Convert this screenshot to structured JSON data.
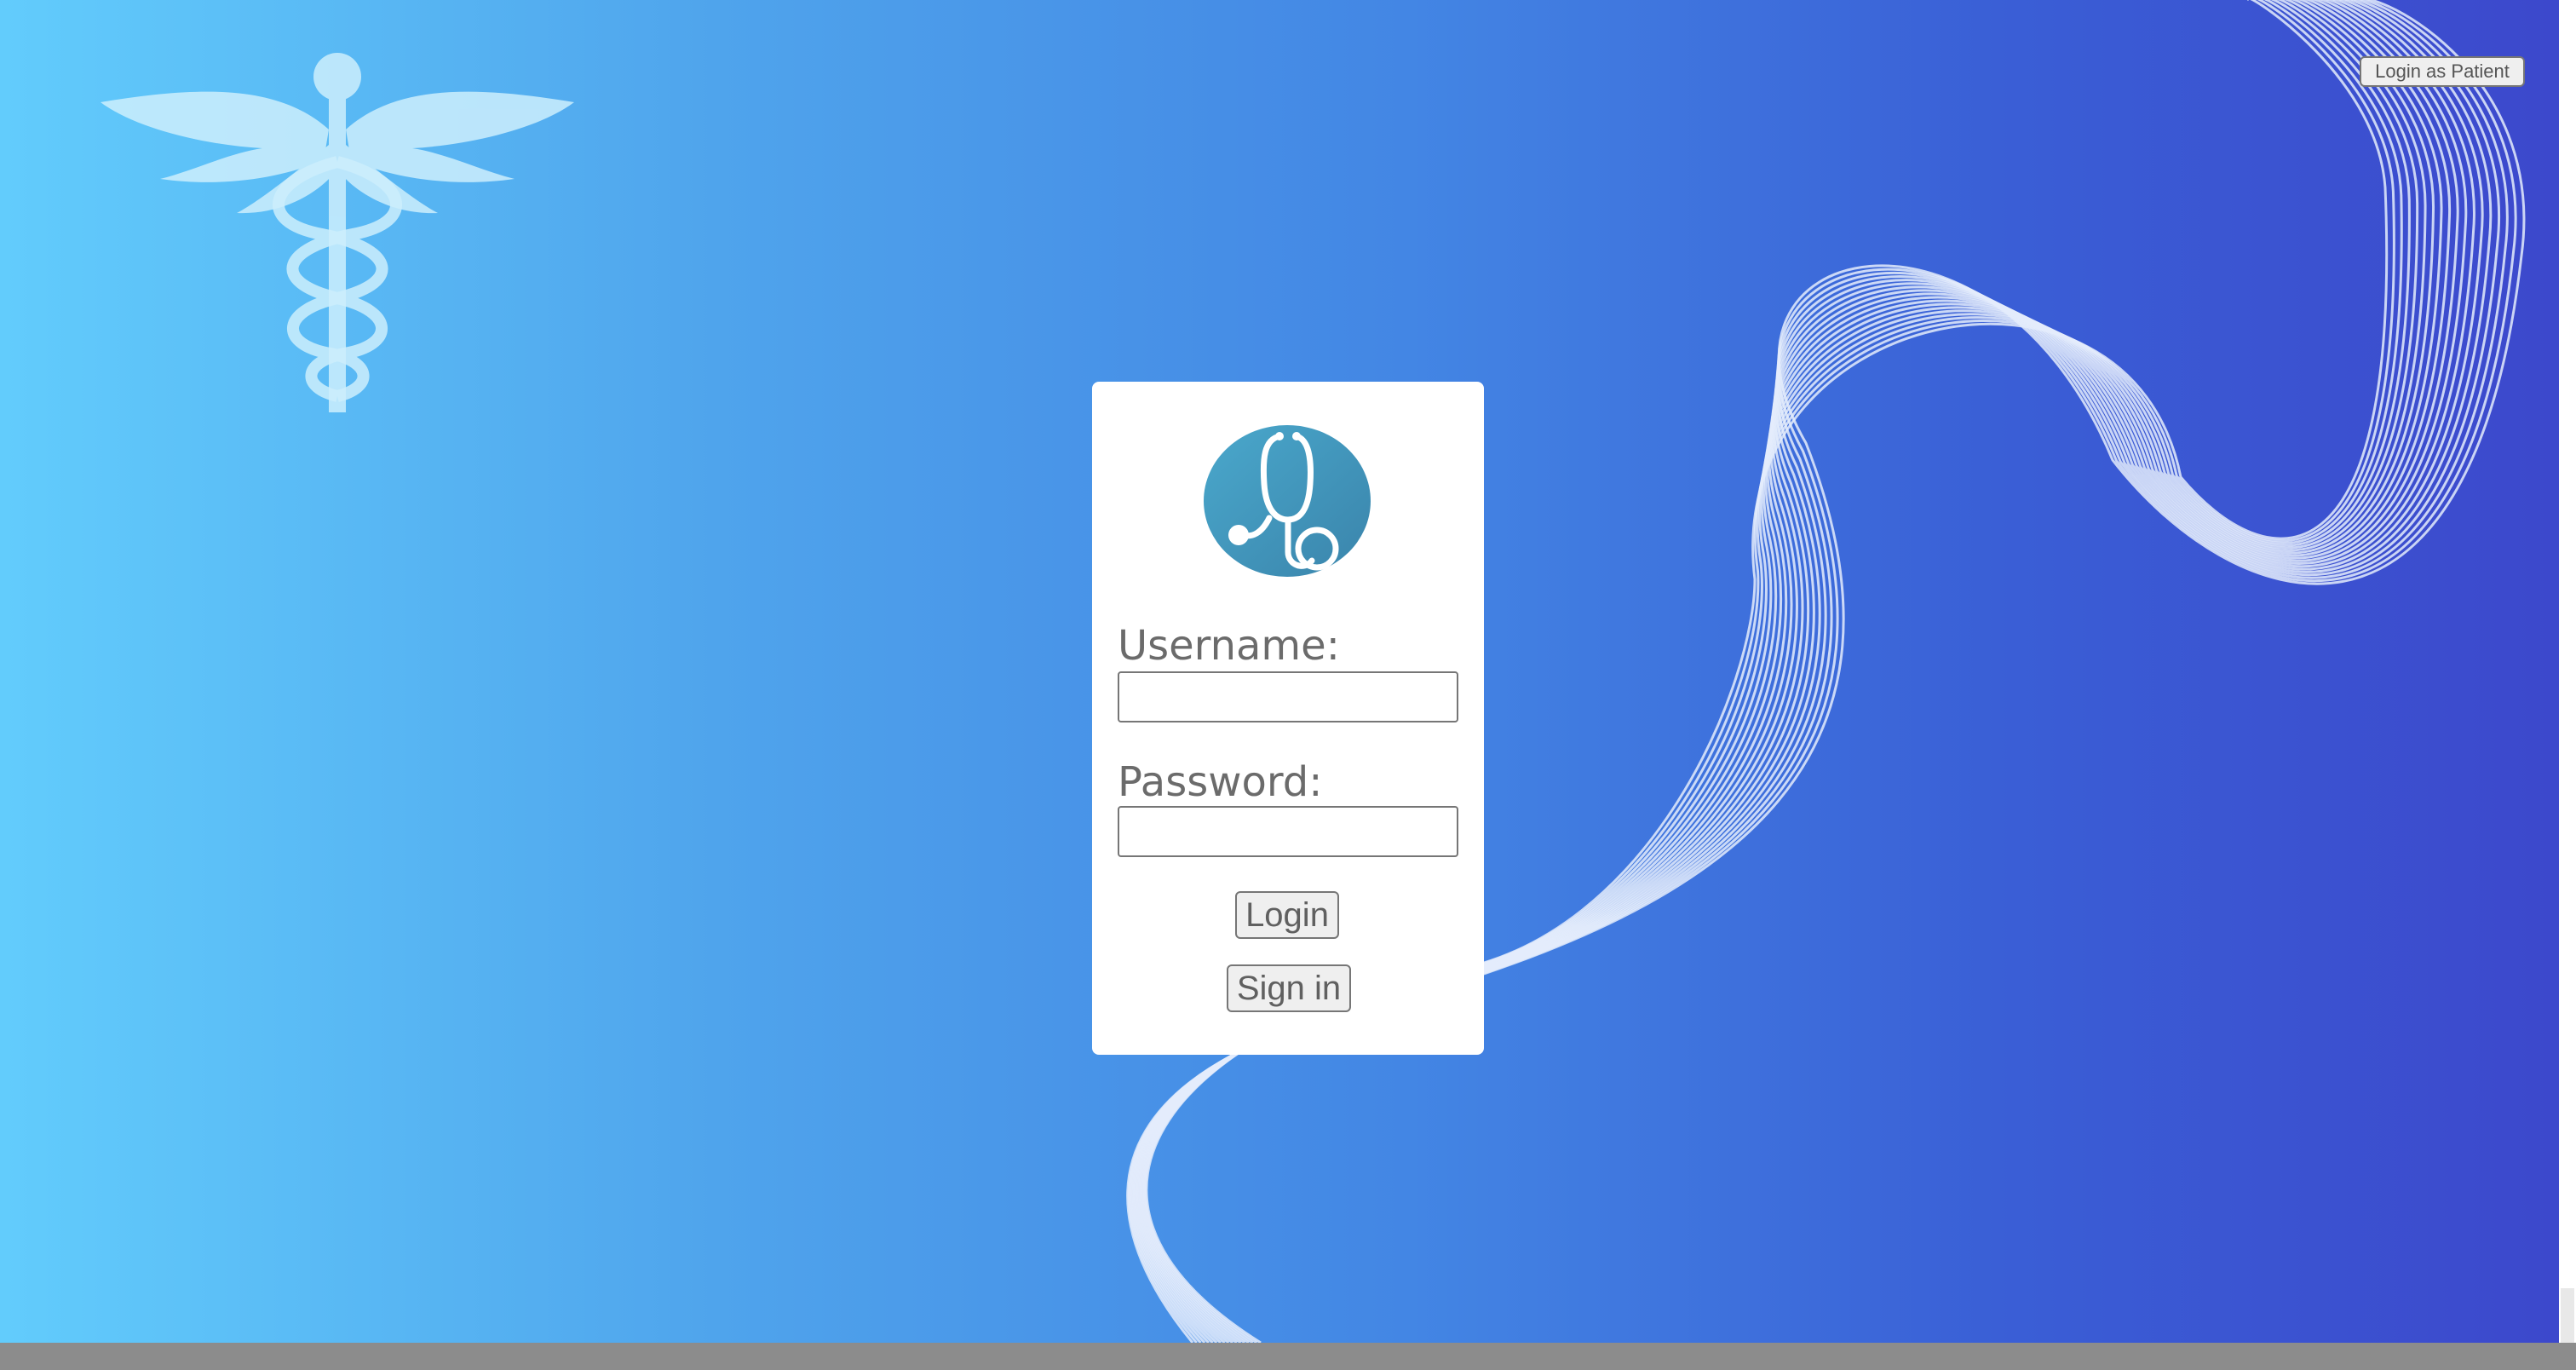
{
  "header": {
    "patient_login_label": "Login as Patient"
  },
  "login_card": {
    "logo_icon": "stethoscope-icon",
    "username_label": "Username:",
    "username_value": "",
    "password_label": "Password:",
    "password_value": "",
    "login_label": "Login",
    "signin_label": "Sign in"
  },
  "decor": {
    "background_icon": "caduceus-icon"
  },
  "colors": {
    "gradient_start": "#62ccfc",
    "gradient_end": "#3c48cc",
    "logo_circle": "#3f93b8",
    "card_background": "#ffffff",
    "label_text": "#6b6b6b"
  }
}
